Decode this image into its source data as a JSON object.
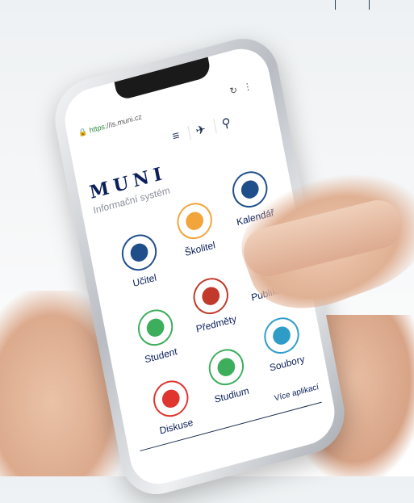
{
  "browser": {
    "url_scheme": "https:",
    "url_rest": "//is.muni.cz"
  },
  "header": {
    "logo": "MUNI",
    "subtitle": "Informační systém"
  },
  "apps": [
    {
      "label": "Učitel",
      "color": "#1f4f8b"
    },
    {
      "label": "Školitel",
      "color": "#f2a53b"
    },
    {
      "label": "Kalendář",
      "color": "#1f4f8b"
    },
    {
      "label": "Student",
      "color": "#3cae5c"
    },
    {
      "label": "Předměty",
      "color": "#c0392b"
    },
    {
      "label": "Publikace",
      "color": "#1f4f8b"
    },
    {
      "label": "Diskuse",
      "color": "#e0342f"
    },
    {
      "label": "Studium",
      "color": "#3cae5c"
    },
    {
      "label": "Soubory",
      "color": "#2e9cc7"
    }
  ],
  "footer": {
    "more_label": "Více aplikací"
  }
}
